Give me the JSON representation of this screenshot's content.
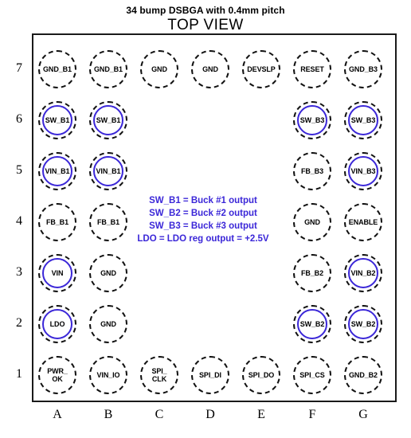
{
  "titles": {
    "subtitle": "34 bump DSBGA with 0.4mm pitch",
    "main": "TOP VIEW"
  },
  "axes": {
    "columns": [
      "A",
      "B",
      "C",
      "D",
      "E",
      "F",
      "G"
    ],
    "rows": [
      "7",
      "6",
      "5",
      "4",
      "3",
      "2",
      "1"
    ]
  },
  "legend": {
    "lines": [
      "SW_B1 = Buck #1 output",
      "SW_B2 = Buck #2 output",
      "SW_B3 = Buck #3 output",
      "LDO = LDO reg output = +2.5V"
    ]
  },
  "colors": {
    "highlight": "#3b27d8",
    "outline": "#1a1a1a",
    "pad_border": "#111111"
  },
  "pads": [
    {
      "ref": "A7",
      "col": "A",
      "row": "7",
      "label": "GND_B1",
      "highlight": false
    },
    {
      "ref": "B7",
      "col": "B",
      "row": "7",
      "label": "GND_B1",
      "highlight": false
    },
    {
      "ref": "C7",
      "col": "C",
      "row": "7",
      "label": "GND",
      "highlight": false
    },
    {
      "ref": "D7",
      "col": "D",
      "row": "7",
      "label": "GND",
      "highlight": false
    },
    {
      "ref": "E7",
      "col": "E",
      "row": "7",
      "label": "DEVSLP",
      "highlight": false
    },
    {
      "ref": "F7",
      "col": "F",
      "row": "7",
      "label": "RESET",
      "highlight": false
    },
    {
      "ref": "G7",
      "col": "G",
      "row": "7",
      "label": "GND_B3",
      "highlight": false
    },
    {
      "ref": "A6",
      "col": "A",
      "row": "6",
      "label": "SW_B1",
      "highlight": true
    },
    {
      "ref": "B6",
      "col": "B",
      "row": "6",
      "label": "SW_B1",
      "highlight": true
    },
    {
      "ref": "F6",
      "col": "F",
      "row": "6",
      "label": "SW_B3",
      "highlight": true
    },
    {
      "ref": "G6",
      "col": "G",
      "row": "6",
      "label": "SW_B3",
      "highlight": true
    },
    {
      "ref": "A5",
      "col": "A",
      "row": "5",
      "label": "VIN_B1",
      "highlight": true
    },
    {
      "ref": "B5",
      "col": "B",
      "row": "5",
      "label": "VIN_B1",
      "highlight": true
    },
    {
      "ref": "F5",
      "col": "F",
      "row": "5",
      "label": "FB_B3",
      "highlight": false
    },
    {
      "ref": "G5",
      "col": "G",
      "row": "5",
      "label": "VIN_B3",
      "highlight": true
    },
    {
      "ref": "A4",
      "col": "A",
      "row": "4",
      "label": "FB_B1",
      "highlight": false
    },
    {
      "ref": "B4",
      "col": "B",
      "row": "4",
      "label": "FB_B1",
      "highlight": false
    },
    {
      "ref": "F4",
      "col": "F",
      "row": "4",
      "label": "GND",
      "highlight": false
    },
    {
      "ref": "G4",
      "col": "G",
      "row": "4",
      "label": "ENABLE",
      "highlight": false
    },
    {
      "ref": "A3",
      "col": "A",
      "row": "3",
      "label": "VIN",
      "highlight": true
    },
    {
      "ref": "B3",
      "col": "B",
      "row": "3",
      "label": "GND",
      "highlight": false
    },
    {
      "ref": "F3",
      "col": "F",
      "row": "3",
      "label": "FB_B2",
      "highlight": false
    },
    {
      "ref": "G3",
      "col": "G",
      "row": "3",
      "label": "VIN_B2",
      "highlight": true
    },
    {
      "ref": "A2",
      "col": "A",
      "row": "2",
      "label": "LDO",
      "highlight": true
    },
    {
      "ref": "B2",
      "col": "B",
      "row": "2",
      "label": "GND",
      "highlight": false
    },
    {
      "ref": "F2",
      "col": "F",
      "row": "2",
      "label": "SW_B2",
      "highlight": true
    },
    {
      "ref": "G2",
      "col": "G",
      "row": "2",
      "label": "SW_B2",
      "highlight": true
    },
    {
      "ref": "A1",
      "col": "A",
      "row": "1",
      "label": "PWR_\nOK",
      "highlight": false
    },
    {
      "ref": "B1",
      "col": "B",
      "row": "1",
      "label": "VIN_IO",
      "highlight": false
    },
    {
      "ref": "C1",
      "col": "C",
      "row": "1",
      "label": "SPI_\nCLK",
      "highlight": false
    },
    {
      "ref": "D1",
      "col": "D",
      "row": "1",
      "label": "SPI_DI",
      "highlight": false
    },
    {
      "ref": "E1",
      "col": "E",
      "row": "1",
      "label": "SPI_DO",
      "highlight": false
    },
    {
      "ref": "F1",
      "col": "F",
      "row": "1",
      "label": "SPI_CS",
      "highlight": false
    },
    {
      "ref": "G1",
      "col": "G",
      "row": "1",
      "label": "GND_B2",
      "highlight": false
    }
  ]
}
